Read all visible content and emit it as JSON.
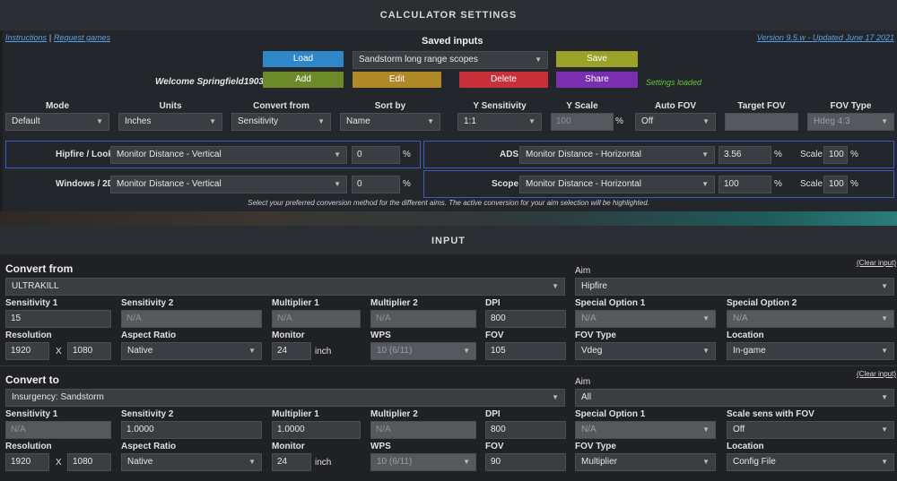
{
  "header": {
    "title": "CALCULATOR SETTINGS"
  },
  "links": {
    "instructions": "Instructions",
    "separator": "|",
    "request_games": "Request games",
    "version": "Version 9.5.w - Updated June 17 2021"
  },
  "saved": {
    "title": "Saved inputs",
    "selected": "Sandstorm long range scopes",
    "welcome": "Welcome Springfield1903!",
    "status": "Settings loaded",
    "buttons": {
      "load": "Load",
      "save": "Save",
      "add": "Add",
      "edit": "Edit",
      "delete": "Delete",
      "share": "Share"
    }
  },
  "settings": [
    {
      "label": "Mode",
      "value": "Default",
      "disabled": false
    },
    {
      "label": "Units",
      "value": "Inches",
      "disabled": false
    },
    {
      "label": "Convert from",
      "value": "Sensitivity",
      "disabled": false
    },
    {
      "label": "Sort by",
      "value": "Name",
      "disabled": false
    },
    {
      "label": "Y Sensitivity",
      "value": "1:1",
      "disabled": false
    },
    {
      "label": "Y Scale",
      "value": "100",
      "disabled": true
    },
    {
      "label": "Auto FOV",
      "value": "Off",
      "disabled": false
    },
    {
      "label": "Target FOV",
      "value": "",
      "disabled": true
    },
    {
      "label": "FOV Type",
      "value": "Hdeg 4:3",
      "disabled": true
    }
  ],
  "conversion": {
    "hipfire": {
      "label": "Hipfire / Look",
      "method": "Monitor Distance - Vertical",
      "value": "0",
      "unit": "%"
    },
    "windows": {
      "label": "Windows / 2D",
      "method": "Monitor Distance - Vertical",
      "value": "0",
      "unit": "%"
    },
    "ads": {
      "label": "ADS",
      "method": "Monitor Distance - Horizontal",
      "value": "3.56",
      "unit": "%",
      "scale_label": "Scale",
      "scale": "100"
    },
    "scope": {
      "label": "Scope",
      "method": "Monitor Distance - Horizontal",
      "value": "100",
      "unit": "%",
      "scale_label": "Scale",
      "scale": "100"
    },
    "note": "Select your preferred conversion method for the different aims. The active conversion for your aim selection will be highlighted."
  },
  "input": {
    "title": "INPUT",
    "clear": "(Clear input)",
    "from": {
      "heading": "Convert from",
      "game": "ULTRAKILL",
      "aim_label": "Aim",
      "aim": "Hipfire",
      "sens1_label": "Sensitivity 1",
      "sens1": "15",
      "sens2_label": "Sensitivity 2",
      "sens2": "N/A",
      "mult1_label": "Multiplier 1",
      "mult1": "N/A",
      "mult2_label": "Multiplier 2",
      "mult2": "N/A",
      "dpi_label": "DPI",
      "dpi": "800",
      "sp1_label": "Special Option 1",
      "sp1": "N/A",
      "sp2_label": "Special Option 2",
      "sp2": "N/A",
      "res_label": "Resolution",
      "res_w": "1920",
      "res_x": "X",
      "res_h": "1080",
      "aspect_label": "Aspect Ratio",
      "aspect": "Native",
      "monitor_label": "Monitor",
      "monitor": "24",
      "monitor_unit": "inch",
      "wps_label": "WPS",
      "wps": "10 (6/11)",
      "fov_label": "FOV",
      "fov": "105",
      "fovtype_label": "FOV Type",
      "fovtype": "Vdeg",
      "location_label": "Location",
      "location": "In-game"
    },
    "to": {
      "heading": "Convert to",
      "game": "Insurgency: Sandstorm",
      "aim_label": "Aim",
      "aim": "All",
      "sens1_label": "Sensitivity 1",
      "sens1": "N/A",
      "sens2_label": "Sensitivity 2",
      "sens2": "1.0000",
      "mult1_label": "Multiplier 1",
      "mult1": "1.0000",
      "mult2_label": "Multiplier 2",
      "mult2": "N/A",
      "dpi_label": "DPI",
      "dpi": "800",
      "sp1_label": "Special Option 1",
      "sp1": "N/A",
      "scale_label": "Scale sens with FOV",
      "scale": "Off",
      "res_label": "Resolution",
      "res_w": "1920",
      "res_x": "X",
      "res_h": "1080",
      "aspect_label": "Aspect Ratio",
      "aspect": "Native",
      "monitor_label": "Monitor",
      "monitor": "24",
      "monitor_unit": "inch",
      "wps_label": "WPS",
      "wps": "10 (6/11)",
      "fov_label": "FOV",
      "fov": "90",
      "fovtype_label": "FOV Type",
      "fovtype": "Multiplier",
      "location_label": "Location",
      "location": "Config File"
    }
  },
  "colors": {
    "load": "#2f86c8",
    "save": "#9aa22a",
    "add": "#6d8a2a",
    "edit": "#b08a28",
    "delete": "#c8303a",
    "share": "#7a2fb0",
    "status": "#5cc83a",
    "highlight": "#3b5bbf"
  }
}
